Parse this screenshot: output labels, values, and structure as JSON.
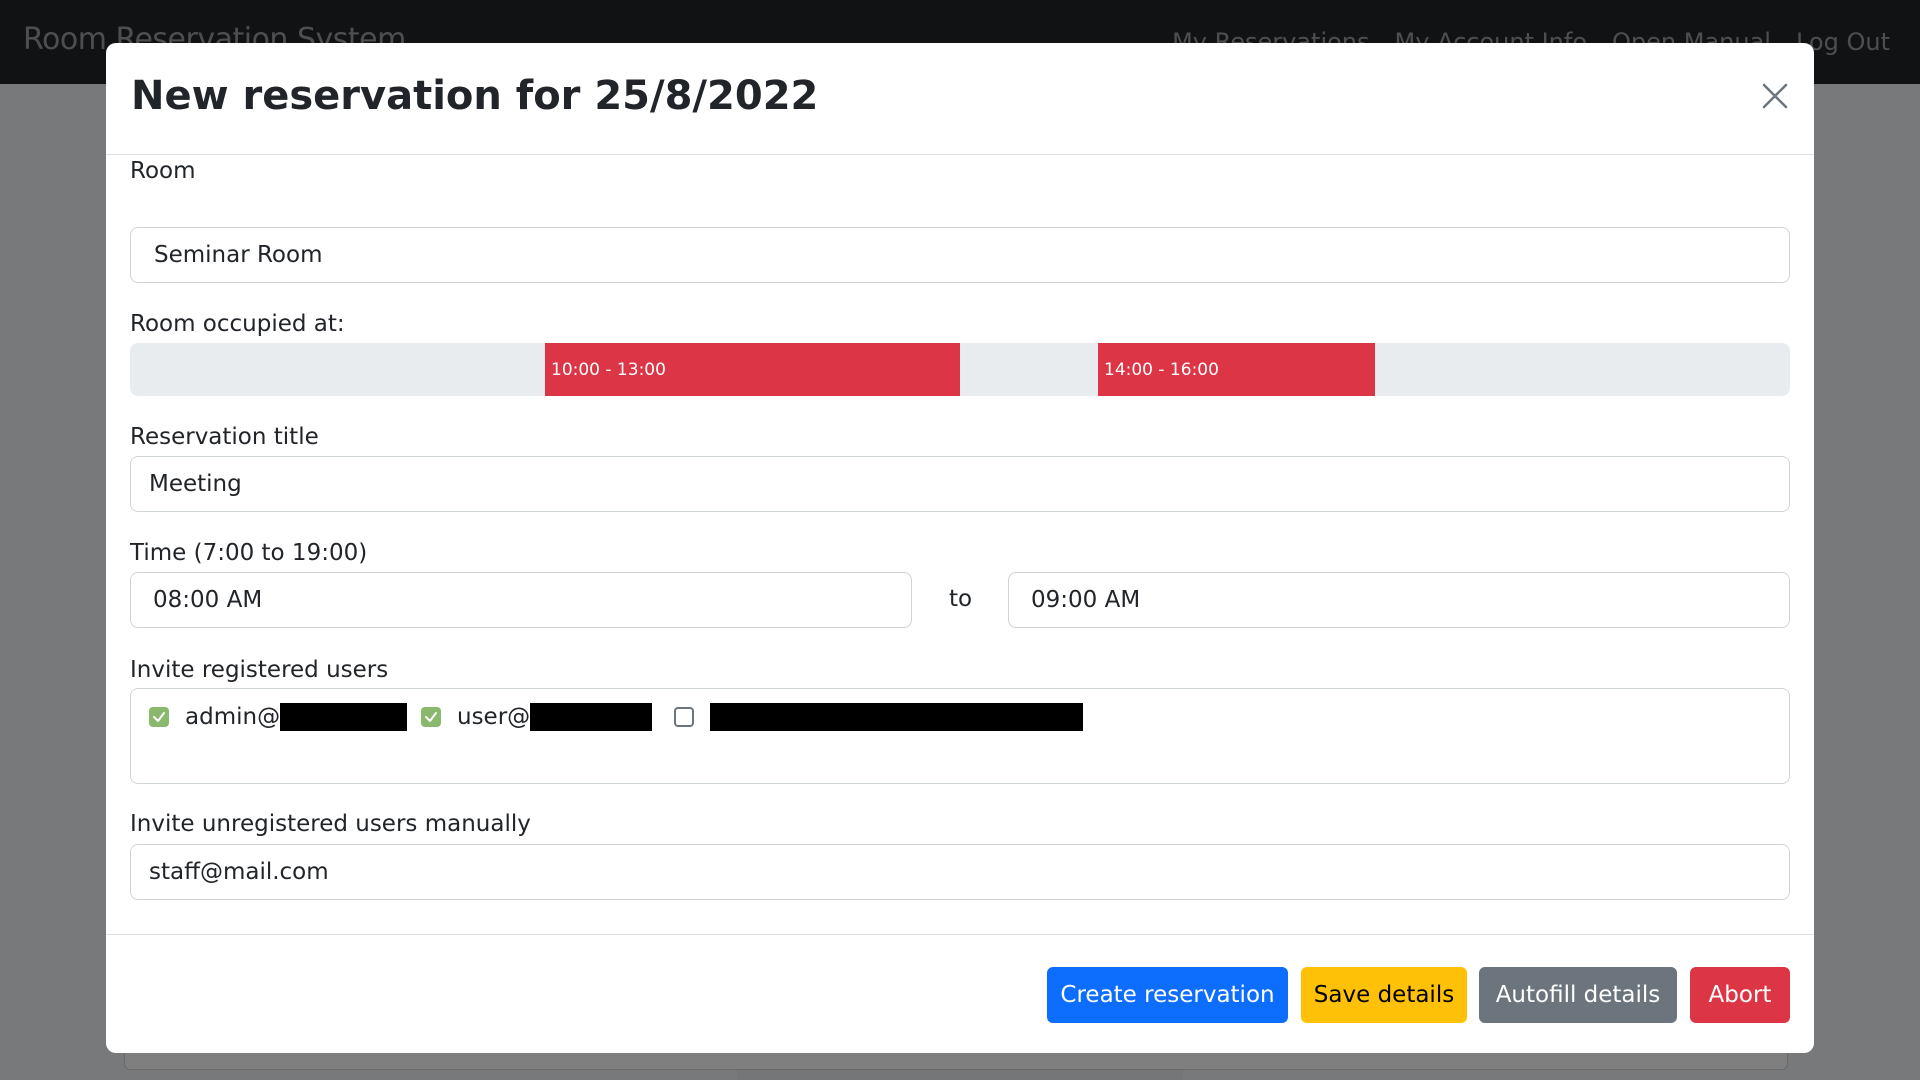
{
  "navbar": {
    "brand": "Room Reservation System",
    "links": [
      "My Reservations",
      "My Account Info",
      "Open Manual",
      "Log Out"
    ]
  },
  "modal": {
    "title": "New reservation for 25/8/2022",
    "room": {
      "label": "Room",
      "value": "Seminar Room"
    },
    "occupancy": {
      "label": "Room occupied at:",
      "blocks": [
        "10:00 - 13:00",
        "14:00 - 16:00"
      ],
      "block_color": "#dc3545"
    },
    "reservation_title": {
      "label": "Reservation title",
      "value": "Meeting"
    },
    "time": {
      "label": "Time (7:00 to 19:00)",
      "start": "08:00  AM",
      "to": "to",
      "end": "09:00  AM"
    },
    "registered_users": {
      "label": "Invite registered users",
      "users": [
        {
          "prefix": "admin@",
          "checked": true
        },
        {
          "prefix": "user@",
          "checked": true
        },
        {
          "prefix": "",
          "checked": false
        }
      ]
    },
    "unregistered_users": {
      "label": "Invite unregistered users manually",
      "value": "staff@mail.com"
    },
    "buttons": {
      "create": "Create reservation",
      "save": "Save details",
      "autofill": "Autofill details",
      "abort": "Abort"
    }
  }
}
